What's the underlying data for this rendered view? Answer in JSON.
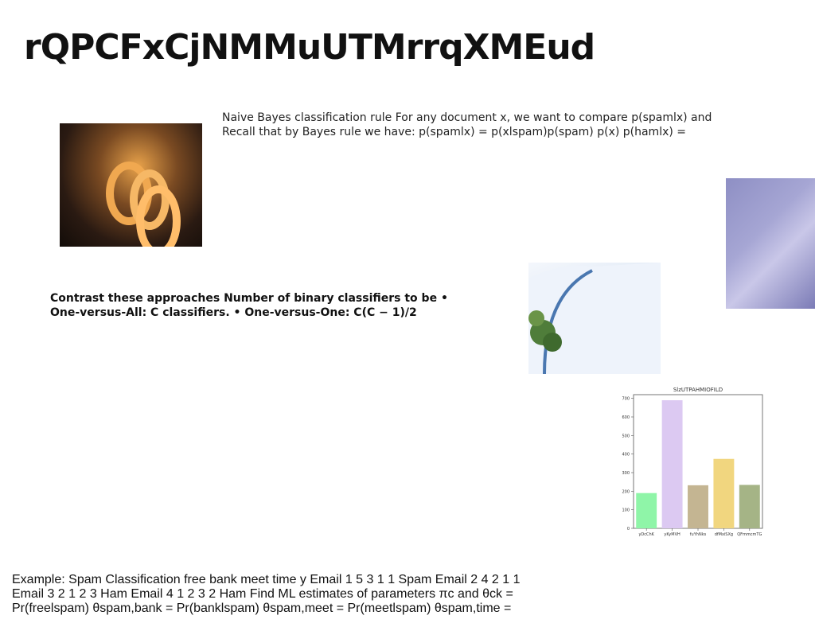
{
  "slide": {
    "title": "rQPCFxCjNMMuUTMrrqXMEud",
    "bayes_text": "Naive Bayes classification rule For any document x, we want to compare p(spamlx) and Recall that by Bayes rule we have: p(spamlx) = p(xlspam)p(spam) p(x) p(hamlx) =",
    "contrast_text": "Contrast these approaches Number of binary classifiers to be • One-versus-All: C classifiers. • One-versus-One: C(C − 1)/2",
    "example_text": "Example: Spam Classification free bank meet time y Email 1 5 3 1 1 Spam Email 2 4 2 1 1 Email 3 2 1 2 3 Ham Email 4 1 2 3 2 Ham Find ML estimates of parameters πc and θck = Pr(freelspam) θspam,bank = Pr(banklspam) θspam,meet = Pr(meetlspam) θspam,time ="
  },
  "chart_data": {
    "type": "bar",
    "title": "SlzUTPAHMIOFILD",
    "categories": [
      "yDcChK",
      "yKyMVH",
      "fuYhNks",
      "dfMxiSXg",
      "QFmmcmTG"
    ],
    "values": [
      190,
      690,
      232,
      374,
      234
    ],
    "colors": [
      "#8ff5a8",
      "#dcc9f2",
      "#c4b592",
      "#f1d67f",
      "#a5b486"
    ],
    "ylim": [
      0,
      720
    ],
    "yticks": [
      0,
      100,
      200,
      300,
      400,
      500,
      600,
      700
    ],
    "xlabel": "",
    "ylabel": "",
    "grid": false
  }
}
